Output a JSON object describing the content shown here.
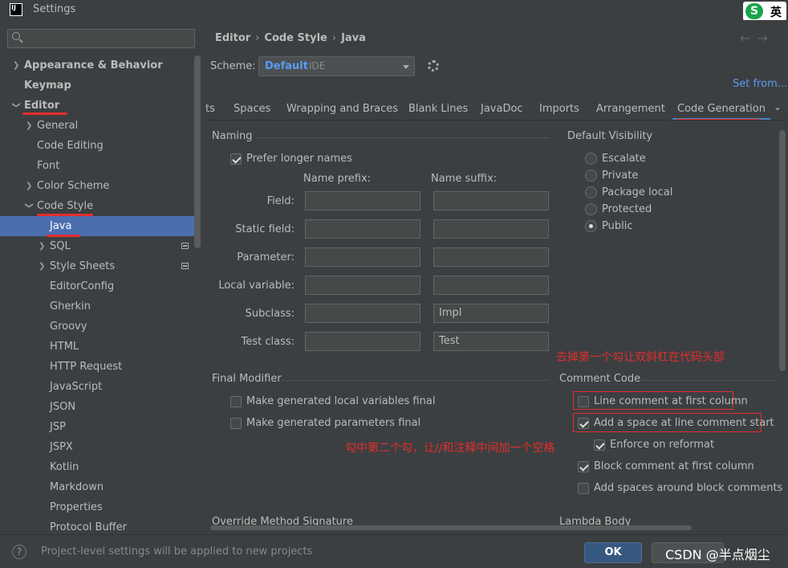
{
  "window": {
    "title": "Settings",
    "app_icon": "IJ"
  },
  "ime": {
    "s": "S",
    "lang": "英"
  },
  "search": {
    "placeholder": ""
  },
  "sidebar": {
    "items": [
      {
        "label": "Appearance & Behavior"
      },
      {
        "label": "Keymap"
      },
      {
        "label": "Editor"
      },
      {
        "label": "General"
      },
      {
        "label": "Code Editing"
      },
      {
        "label": "Font"
      },
      {
        "label": "Color Scheme"
      },
      {
        "label": "Code Style"
      },
      {
        "label": "Java"
      },
      {
        "label": "SQL"
      },
      {
        "label": "Style Sheets"
      },
      {
        "label": "EditorConfig"
      },
      {
        "label": "Gherkin"
      },
      {
        "label": "Groovy"
      },
      {
        "label": "HTML"
      },
      {
        "label": "HTTP Request"
      },
      {
        "label": "JavaScript"
      },
      {
        "label": "JSON"
      },
      {
        "label": "JSP"
      },
      {
        "label": "JSPX"
      },
      {
        "label": "Kotlin"
      },
      {
        "label": "Markdown"
      },
      {
        "label": "Properties"
      },
      {
        "label": "Protocol Buffer"
      }
    ]
  },
  "breadcrumb": [
    "Editor",
    "Code Style",
    "Java"
  ],
  "nav": {
    "back": "←",
    "forward": "→"
  },
  "scheme": {
    "label": "Scheme:",
    "name": "Default",
    "sub": "IDE",
    "set_from": "Set from..."
  },
  "tabs": [
    "ts",
    "Spaces",
    "Wrapping and Braces",
    "Blank Lines",
    "JavaDoc",
    "Imports",
    "Arrangement",
    "Code Generation"
  ],
  "naming": {
    "title": "Naming",
    "prefer_longer": "Prefer longer names",
    "prefix_head": "Name prefix:",
    "suffix_head": "Name suffix:",
    "rows": [
      {
        "label": "Field:",
        "prefix": "",
        "suffix": ""
      },
      {
        "label": "Static field:",
        "prefix": "",
        "suffix": ""
      },
      {
        "label": "Parameter:",
        "prefix": "",
        "suffix": ""
      },
      {
        "label": "Local variable:",
        "prefix": "",
        "suffix": ""
      },
      {
        "label": "Subclass:",
        "prefix": "",
        "suffix": "Impl"
      },
      {
        "label": "Test class:",
        "prefix": "",
        "suffix": "Test"
      }
    ]
  },
  "visibility": {
    "title": "Default Visibility",
    "options": [
      "Escalate",
      "Private",
      "Package local",
      "Protected",
      "Public"
    ],
    "selected": "Public"
  },
  "final_modifier": {
    "title": "Final Modifier",
    "local_vars": "Make generated local variables final",
    "params": "Make generated parameters final"
  },
  "comment_code": {
    "title": "Comment Code",
    "items": [
      {
        "label": "Line comment at first column",
        "checked": false
      },
      {
        "label": "Add a space at line comment start",
        "checked": true
      },
      {
        "label": "Enforce on reformat",
        "checked": true
      },
      {
        "label": "Block comment at first column",
        "checked": true
      },
      {
        "label": "Add spaces around block comments",
        "checked": false
      }
    ]
  },
  "override": {
    "title": "Override Method Signature"
  },
  "lambda": {
    "title": "Lambda Body"
  },
  "annotations": {
    "note1": "去掉第一个勾让双斜杠在代码头部",
    "note2": "勾中第二个勾，让//和注释中间加一个空格"
  },
  "footer": {
    "help": "?",
    "text": "Project-level settings will be applied to new projects",
    "ok": "OK",
    "watermark": "CSDN @半点烟尘"
  },
  "colors": {
    "accent": "#4b6eaf",
    "link": "#589df6",
    "annotation": "#e52d2d"
  }
}
